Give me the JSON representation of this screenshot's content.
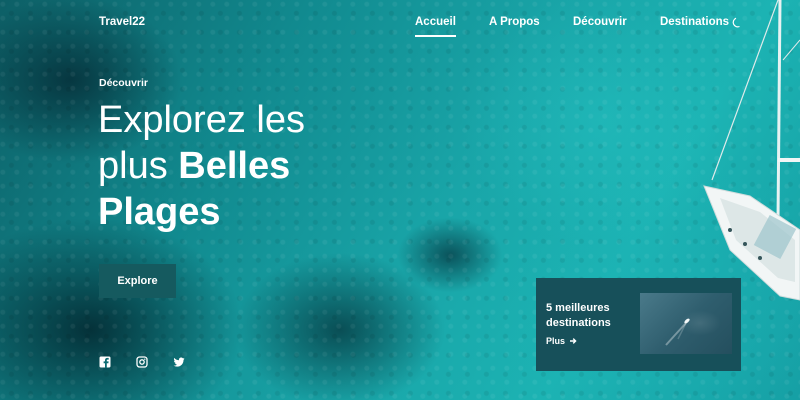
{
  "brand": "Travel22",
  "nav": {
    "items": [
      {
        "label": "Accueil",
        "active": true
      },
      {
        "label": "A Propos",
        "active": false
      },
      {
        "label": "Découvrir",
        "active": false
      },
      {
        "label": "Destinations",
        "active": false
      }
    ],
    "theme_icon": "moon-icon"
  },
  "hero": {
    "kicker": "Découvrir",
    "headline_line1": "Explorez les",
    "headline_plain": "plus ",
    "headline_strong1": "Belles",
    "headline_strong2": "Plages",
    "button_label": "Explore"
  },
  "social": [
    "facebook-icon",
    "instagram-icon",
    "twitter-icon"
  ],
  "card": {
    "title": "5 meilleures destinations",
    "link_label": "Plus",
    "link_icon": "arrow-right-icon"
  },
  "colors": {
    "sea_dark": "#0d5f66",
    "sea_light": "#1cb3b3",
    "button_bg": "#155a5f",
    "card_bg": "#17505a",
    "text": "#ffffff"
  }
}
